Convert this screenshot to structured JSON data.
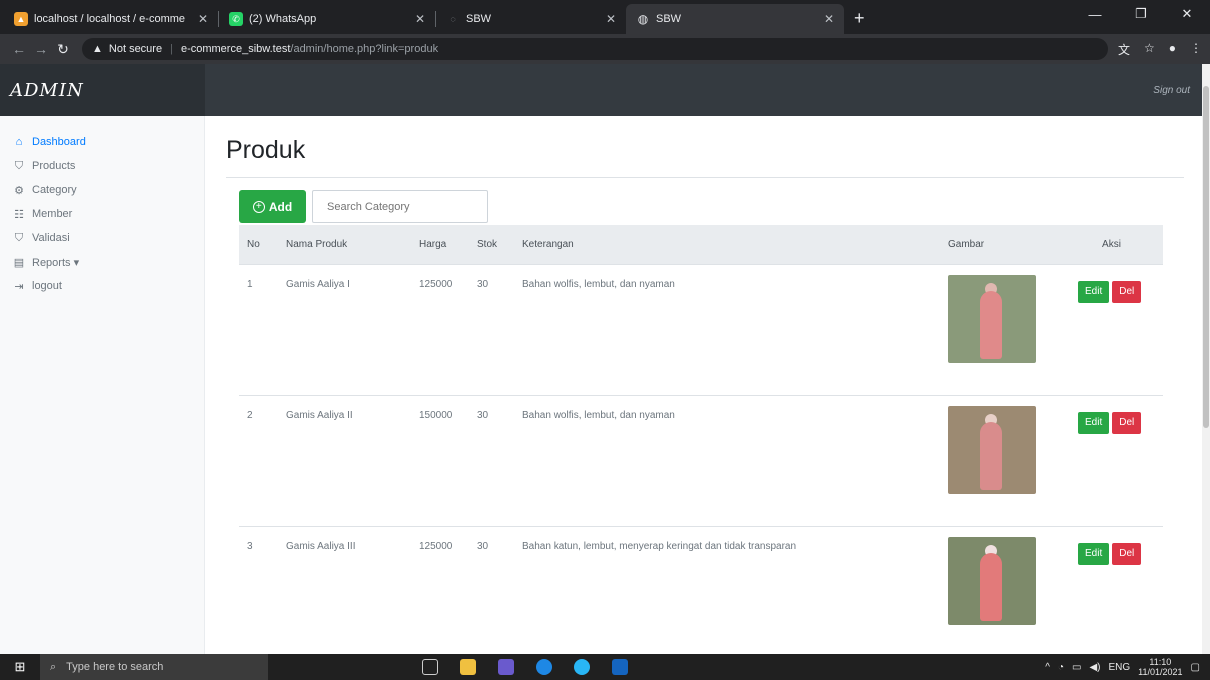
{
  "browser": {
    "tabs": [
      {
        "title": "localhost / localhost / e-comme",
        "color": "#f0a030",
        "glyph": "▲",
        "active": false
      },
      {
        "title": "(2) WhatsApp",
        "color": "#25d366",
        "glyph": "✆",
        "active": false
      },
      {
        "title": "SBW",
        "color": "#5f6368",
        "glyph": "◌",
        "active": false
      },
      {
        "title": "SBW",
        "color": "#8ab4f8",
        "glyph": "◍",
        "active": true
      }
    ],
    "address": {
      "security_label": "Not secure",
      "host": "e-commerce_sibw.test",
      "path": "/admin/home.php?link=produk"
    }
  },
  "app": {
    "brand": "ADMIN",
    "signout": "Sign out"
  },
  "sidebar": {
    "items": [
      {
        "label": "Dashboard",
        "icon": "⌂",
        "active": true
      },
      {
        "label": "Products",
        "icon": "⛉",
        "active": false
      },
      {
        "label": "Category",
        "icon": "⚙",
        "active": false
      },
      {
        "label": "Member",
        "icon": "☷",
        "active": false
      },
      {
        "label": "Validasi",
        "icon": "⛉",
        "active": false
      },
      {
        "label": "Reports ▾",
        "icon": "▤",
        "active": false
      },
      {
        "label": "logout",
        "icon": "⇥",
        "active": false
      }
    ]
  },
  "main": {
    "title": "Produk",
    "add_label": "Add",
    "search_placeholder": "Search Category",
    "columns": [
      "No",
      "Nama Produk",
      "Harga",
      "Stok",
      "Keterangan",
      "Gambar",
      "Aksi"
    ],
    "rows": [
      {
        "no": "1",
        "nama": "Gamis Aaliya I",
        "harga": "125000",
        "stok": "30",
        "keterangan": "Bahan wolfis, lembut, dan nyaman",
        "bg": "#8a9a7a",
        "dress": "#e08a8a"
      },
      {
        "no": "2",
        "nama": "Gamis Aaliya II",
        "harga": "150000",
        "stok": "30",
        "keterangan": "Bahan wolfis, lembut, dan nyaman",
        "bg": "#9c8a72",
        "dress": "#d98c8c"
      },
      {
        "no": "3",
        "nama": "Gamis Aaliya III",
        "harga": "125000",
        "stok": "30",
        "keterangan": "Bahan katun, lembut, menyerap keringat dan tidak transparan",
        "bg": "#7d8a6a",
        "dress": "#e27a7a"
      }
    ],
    "edit_label": "Edit",
    "del_label": "Del"
  },
  "taskbar": {
    "search_placeholder": "Type here to search",
    "lang": "ENG",
    "time": "11:10",
    "date": "11/01/2021"
  }
}
